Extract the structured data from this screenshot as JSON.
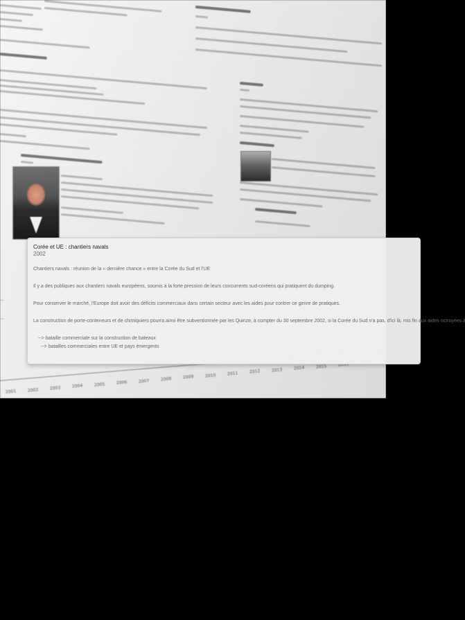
{
  "card": {
    "title": "Corée et UE : chantiers navals",
    "date": "2002",
    "paragraphs": [
      "Chantiers navals : réunion de la « dernière chance » entre la Corée du Sud et l'UE",
      "Il y a des publiques aux chantiers navals européens, soumis à la forte pression de leurs concurrents sud-coréens qui pratiquent du dumping.",
      "Pour conserver le marché, l'Europe doit avoir des déficits commerciaux dans certain secteur avec les aides pour contrer ce genre de pratiques.",
      "La construction de porte-conteneurs et de chimiquiers pourra ainsi être subventionnée par les Quinze, à compter du 30 septembre 2002, si la Corée du Sud n'a pas, d'ici là, mis fin aux aides octroyées à ses industriels qui leur permettent de vendre à perte."
    ],
    "links": [
      "--> bataille commerciale sur la construction de bateaux",
      "--> batailles commerciales entre UE et pays émergents"
    ]
  },
  "timeline": {
    "years": [
      "2001",
      "2002",
      "2003",
      "2004",
      "2005",
      "2006",
      "2007",
      "2008",
      "2009",
      "2010",
      "2011",
      "2012",
      "2013",
      "2014",
      "2015",
      "2016",
      "2017"
    ]
  },
  "colors": {
    "background": "#000000",
    "page": "#f2f2f2",
    "card": "#efefef",
    "card_border": "#cfcfcf"
  }
}
